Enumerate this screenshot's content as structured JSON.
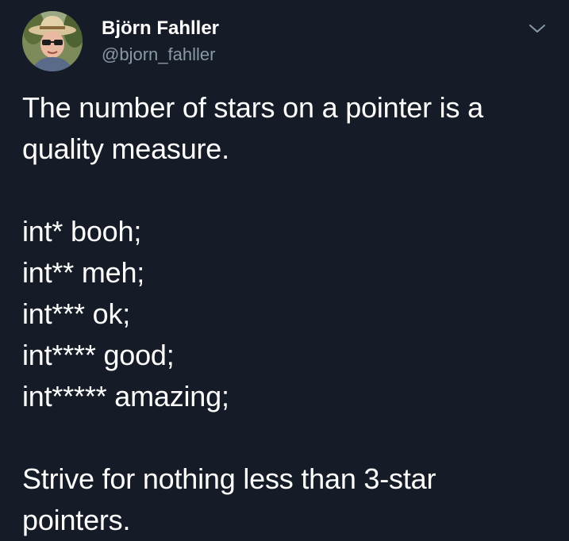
{
  "author": {
    "display_name": "Björn Fahller",
    "handle": "@bjorn_fahller",
    "avatar_icon": "profile-photo"
  },
  "menu": {
    "icon": "chevron-down-icon"
  },
  "tweet": {
    "lines": [
      "The number of stars on a pointer is a",
      "quality measure.",
      "",
      "int* booh;",
      "int** meh;",
      "int*** ok;",
      "int**** good;",
      "int***** amazing;",
      "",
      "Strive for nothing less than 3-star",
      "pointers."
    ]
  },
  "colors": {
    "background": "#161c27",
    "text": "#ffffff",
    "secondary_text": "#8899a6"
  }
}
